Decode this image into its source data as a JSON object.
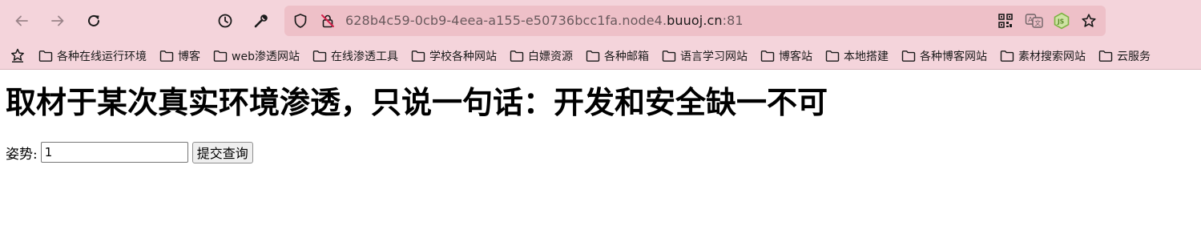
{
  "browser": {
    "nav": {
      "back_icon": "arrow-left-icon",
      "forward_icon": "arrow-right-icon",
      "reload_icon": "reload-icon",
      "history_icon": "clock-icon",
      "devtools_icon": "wrench-icon"
    },
    "urlbar": {
      "url_prefix": "628b4c59-0cb9-4eea-a155-e50736bcc1fa.node4.",
      "url_host": "buuoj.cn",
      "url_port": ":81",
      "shield_icon": "shield-icon",
      "insecure_icon": "insecure-lock-icon",
      "qr_icon": "qr-code-icon",
      "translate_icon": "translate-icon",
      "extension_icon": "nodejs-icon",
      "bookmark_star_icon": "star-icon"
    },
    "bookmarks": [
      "各种在线运行环境",
      "博客",
      "web渗透网站",
      "在线渗透工具",
      "学校各种网站",
      "白嫖资源",
      "各种邮箱",
      "语言学习网站",
      "博客站",
      "本地搭建",
      "各种博客网站",
      "素材搜索网站",
      "云服务"
    ]
  },
  "page": {
    "heading": "取材于某次真实环境渗透，只说一句话：开发和安全缺一不可",
    "form": {
      "label": "姿势:",
      "input_value": "1",
      "submit_label": "提交查询"
    }
  },
  "colors": {
    "chrome_bg": "#f4d4db",
    "urlbar_bg": "#eec0c8",
    "insecure_red": "#d4204a",
    "extension_green": "#7cb342"
  }
}
